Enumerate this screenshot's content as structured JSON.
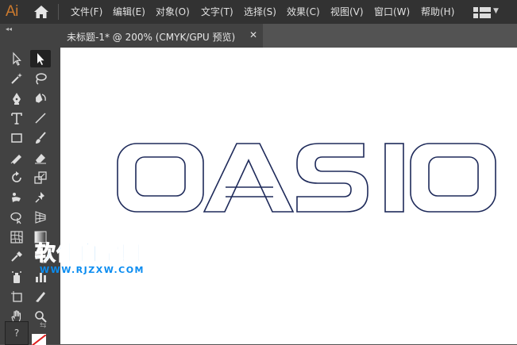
{
  "app": {
    "logo_text": "Ai",
    "logo_color": "#cc7a2e",
    "accent_color": "#1e2a5a"
  },
  "menu": {
    "items": [
      {
        "label": "文件(F)"
      },
      {
        "label": "编辑(E)"
      },
      {
        "label": "对象(O)"
      },
      {
        "label": "文字(T)"
      },
      {
        "label": "选择(S)"
      },
      {
        "label": "效果(C)"
      },
      {
        "label": "视图(V)"
      },
      {
        "label": "窗口(W)"
      },
      {
        "label": "帮助(H)"
      }
    ]
  },
  "toolbar": {
    "collapse_glyph": "◂◂",
    "tools": [
      {
        "icon": "selection-icon"
      },
      {
        "icon": "direct-selection-icon"
      },
      {
        "icon": "magic-wand-icon"
      },
      {
        "icon": "lasso-icon"
      },
      {
        "icon": "pen-icon"
      },
      {
        "icon": "curvature-icon"
      },
      {
        "icon": "type-icon"
      },
      {
        "icon": "line-segment-icon"
      },
      {
        "icon": "rectangle-icon"
      },
      {
        "icon": "paintbrush-icon"
      },
      {
        "icon": "shaper-icon"
      },
      {
        "icon": "eraser-icon"
      },
      {
        "icon": "rotate-icon"
      },
      {
        "icon": "scale-icon"
      },
      {
        "icon": "puppet-warp-icon"
      },
      {
        "icon": "pin-icon"
      },
      {
        "icon": "shape-builder-icon"
      },
      {
        "icon": "perspective-grid-icon"
      },
      {
        "icon": "mesh-icon"
      },
      {
        "icon": "gradient-icon"
      },
      {
        "icon": "eyedropper-icon"
      },
      {
        "icon": "blend-icon"
      },
      {
        "icon": "symbol-sprayer-icon"
      },
      {
        "icon": "column-graph-icon"
      },
      {
        "icon": "artboard-icon"
      },
      {
        "icon": "slice-icon"
      },
      {
        "icon": "hand-icon"
      },
      {
        "icon": "zoom-icon"
      }
    ],
    "help_glyph": "?"
  },
  "document": {
    "tab_label": "未标题-1* @ 200% (CMYK/GPU 预览)",
    "close_glyph": "✕"
  },
  "artwork": {
    "text": "OASIO",
    "stroke_color": "#1e2a5a"
  },
  "watermark": {
    "title": "软件自学网",
    "url": "WWW.RJZXW.COM",
    "color": "#0a8cf0"
  }
}
